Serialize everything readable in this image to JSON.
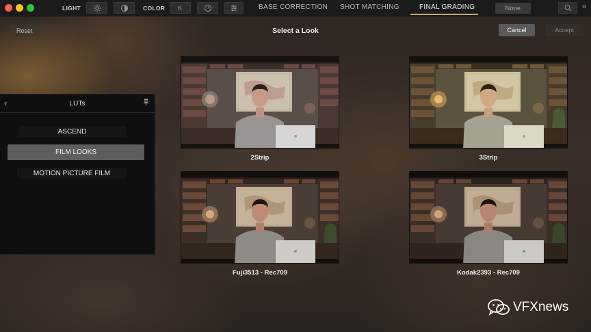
{
  "topbar": {
    "light_label": "LIGHT",
    "color_label": "COLOR",
    "tabs": [
      {
        "label": "BASE CORRECTION"
      },
      {
        "label": "SHOT MATCHING"
      },
      {
        "label": "FINAL GRADING"
      }
    ],
    "active_tab": "FINAL GRADING",
    "none_label": "None",
    "accent_color": "#c9a46a"
  },
  "header": {
    "reset_label": "Reset",
    "title": "Select a Look",
    "cancel_label": "Cancel",
    "accept_label": "Accept"
  },
  "lut_panel": {
    "title": "LUTs",
    "items": [
      {
        "label": "ASCEND"
      },
      {
        "label": "FILM LOOKS"
      },
      {
        "label": "MOTION PICTURE FILM"
      }
    ],
    "selected": "FILM LOOKS"
  },
  "looks": [
    {
      "label": "2Strip"
    },
    {
      "label": "3Strip"
    },
    {
      "label": "Fuji3513 - Rec709"
    },
    {
      "label": "Kodak2393 - Rec709"
    }
  ],
  "watermark": {
    "text": "VFXnews"
  }
}
